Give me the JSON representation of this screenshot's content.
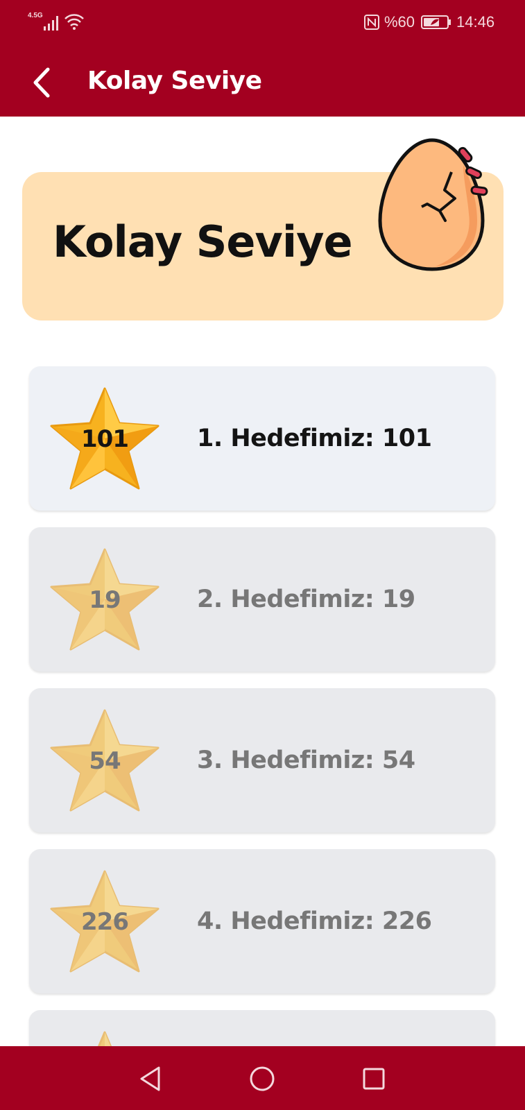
{
  "status_bar": {
    "network": "4.5G",
    "battery": "%60",
    "time": "14:46"
  },
  "app_bar": {
    "title": "Kolay Seviye"
  },
  "header": {
    "title": "Kolay Seviye",
    "icon": "cracked-egg-icon"
  },
  "levels": [
    {
      "number": "101",
      "label": "1. Hedefimiz: 101",
      "state": "unlocked"
    },
    {
      "number": "19",
      "label": "2. Hedefimiz: 19",
      "state": "locked"
    },
    {
      "number": "54",
      "label": "3. Hedefimiz: 54",
      "state": "locked"
    },
    {
      "number": "226",
      "label": "4. Hedefimiz: 226",
      "state": "locked"
    },
    {
      "number": "",
      "label": "",
      "state": "locked"
    }
  ],
  "nav_bar": {
    "buttons": [
      "back-triangle-icon",
      "home-circle-icon",
      "recents-square-icon"
    ]
  },
  "colors": {
    "primary": "#a30020",
    "header_card": "#ffe0b3",
    "active_card": "#eef1f6",
    "locked_card": "#e9eaed",
    "star": "#f7b21f"
  }
}
